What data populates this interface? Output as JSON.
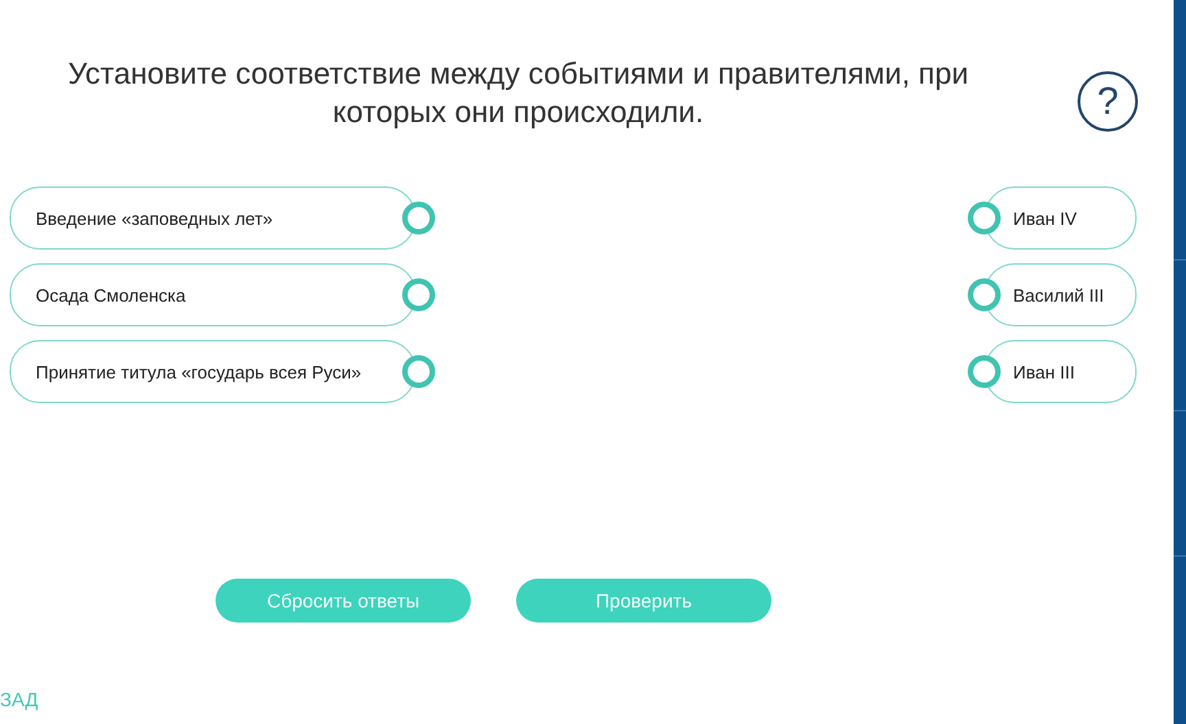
{
  "title": "Установите соответствие между событиями и правителями, при которых они происходили.",
  "help": "?",
  "events": [
    {
      "label": "Введение «заповедных лет»"
    },
    {
      "label": "Осада Смоленска"
    },
    {
      "label": "Принятие титула «государь всея Руси»"
    }
  ],
  "rulers": [
    {
      "label": "Иван IV"
    },
    {
      "label": "Василий III"
    },
    {
      "label": "Иван III"
    }
  ],
  "buttons": [
    {
      "label": "Сбросить ответы"
    },
    {
      "label": "Проверить"
    }
  ],
  "back_link": "ЗАД"
}
